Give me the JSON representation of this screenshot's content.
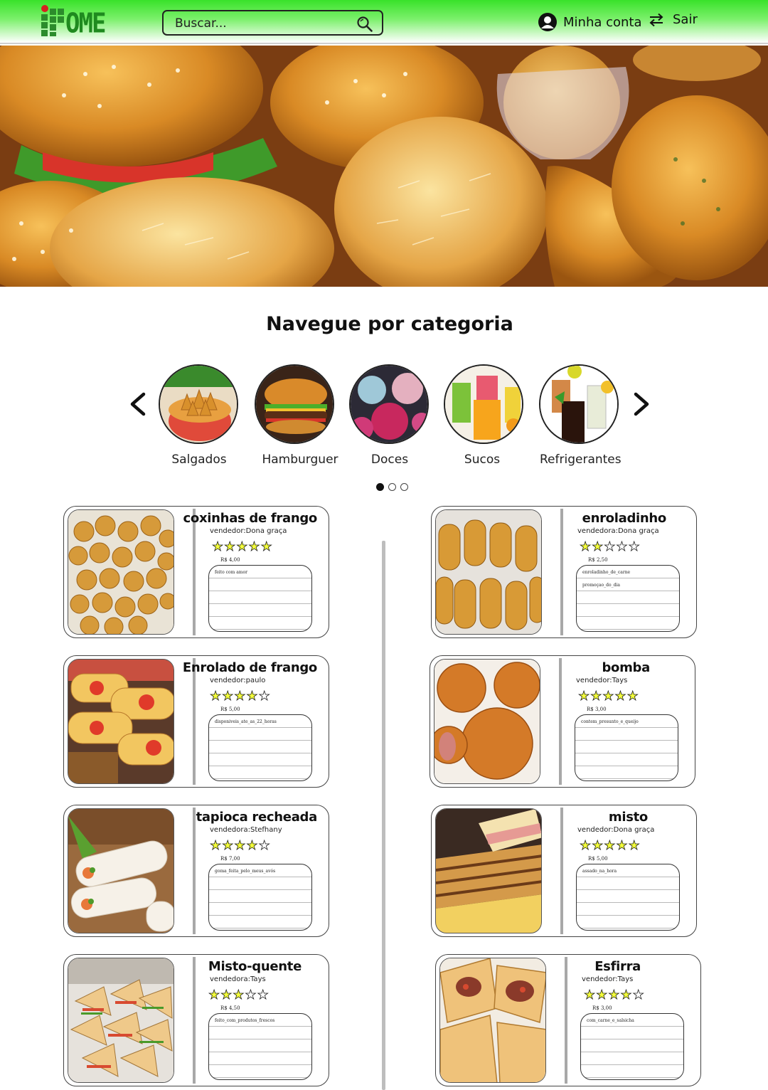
{
  "header": {
    "logo_text": "OME",
    "search_placeholder": "Buscar...",
    "account_label": "Minha conta",
    "logout_label": "Sair",
    "accent": "#39e22a"
  },
  "categories": {
    "title": "Navegue por categoria",
    "items": [
      {
        "label": "Salgados"
      },
      {
        "label": "Hamburguer"
      },
      {
        "label": "Doces"
      },
      {
        "label": "Sucos"
      },
      {
        "label": "Refrigerantes"
      }
    ],
    "page_dots": 3,
    "active_dot": 1
  },
  "products": [
    {
      "name": "coxinhas de frango",
      "seller": "vendedor:Dona graça",
      "rating": 5,
      "price": "R$ 4,00",
      "notes": [
        "feito com amor"
      ]
    },
    {
      "name": "enroladinho",
      "seller": "vendedora:Dona graça",
      "rating": 2,
      "price": "R$ 2,50",
      "notes": [
        "enroladinho_de_carne",
        "promoçao_do_dia"
      ]
    },
    {
      "name": "Enrolado de frango",
      "seller": "vendedor:paulo",
      "rating": 3.5,
      "price": "R$ 5,00",
      "notes": [
        "disponiveis_ate_as_22_horas"
      ]
    },
    {
      "name": "bomba",
      "seller": "vendedor:Tays",
      "rating": 5,
      "price": "R$ 3,00",
      "notes": [
        "contem_presunto_e_queijo"
      ]
    },
    {
      "name": "tapioca recheada",
      "seller": "vendedora:Stefhany",
      "rating": 4,
      "price": "R$ 7,00",
      "notes": [
        "goma_feita_pelo_meus_avós"
      ]
    },
    {
      "name": "misto",
      "seller": "vendedor:Dona graça",
      "rating": 5,
      "price": "R$ 5,00",
      "notes": [
        "assado_na_hora"
      ]
    },
    {
      "name": "Misto-quente",
      "seller": "vendedora:Tays",
      "rating": 3,
      "price": "R$ 4,50",
      "notes": [
        "feito_com_produtos_frescos"
      ]
    },
    {
      "name": "Esfirra",
      "seller": "vendedor:Tays",
      "rating": 4,
      "price": "R$ 3,00",
      "notes": [
        "com_carne_e_salsicha"
      ]
    }
  ]
}
